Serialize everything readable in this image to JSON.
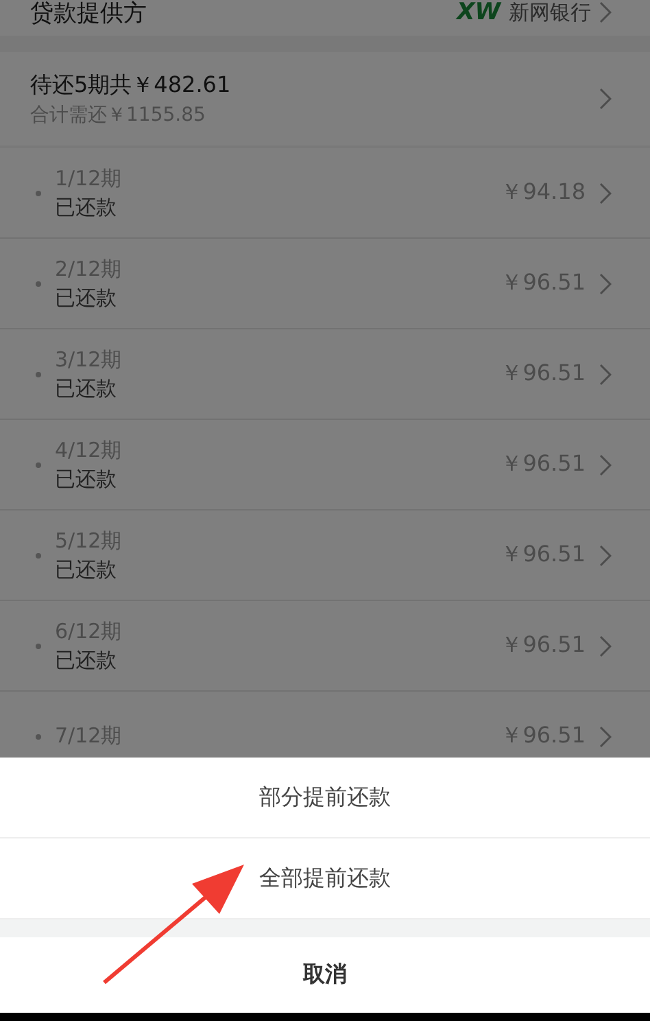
{
  "provider": {
    "label": "贷款提供方",
    "logo": "XW",
    "bank": "新网银行"
  },
  "summary": {
    "title": "待还5期共￥482.61",
    "subtitle": "合计需还￥1155.85"
  },
  "installments": [
    {
      "period": "1/12期",
      "status": "已还款",
      "amount": "￥94.18"
    },
    {
      "period": "2/12期",
      "status": "已还款",
      "amount": "￥96.51"
    },
    {
      "period": "3/12期",
      "status": "已还款",
      "amount": "￥96.51"
    },
    {
      "period": "4/12期",
      "status": "已还款",
      "amount": "￥96.51"
    },
    {
      "period": "5/12期",
      "status": "已还款",
      "amount": "￥96.51"
    },
    {
      "period": "6/12期",
      "status": "已还款",
      "amount": "￥96.51"
    },
    {
      "period": "7/12期",
      "amount": "￥96.51"
    }
  ],
  "action_sheet": {
    "options": [
      "部分提前还款",
      "全部提前还款"
    ],
    "cancel": "取消"
  }
}
